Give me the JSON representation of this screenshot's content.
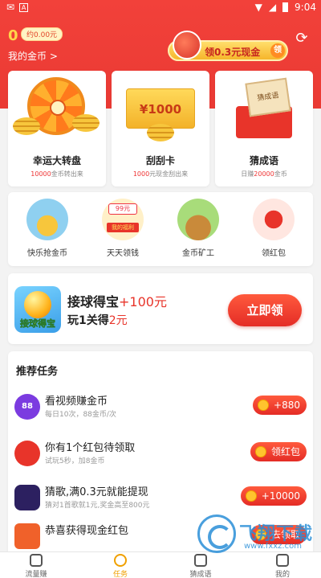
{
  "status": {
    "time": "9:04"
  },
  "header": {
    "coins": "0",
    "coins_value": "约0.00元",
    "my_coins": "我的金币 >",
    "banner_text": "领0.3元现金",
    "banner_tag": "领"
  },
  "top_cards": [
    {
      "title": "幸运大转盘",
      "sub_pre": "10000",
      "sub_post": "金币转出来"
    },
    {
      "title": "刮刮卡",
      "sub_pre": "1000",
      "sub_post": "元现金刮出来",
      "amount": "¥1000"
    },
    {
      "title": "猜成语",
      "sub_pre": "日赚",
      "sub_red": "20000",
      "sub_post": "金币",
      "paper": "猜成语"
    }
  ],
  "mid_items": [
    {
      "label": "快乐抢金币"
    },
    {
      "label": "天天领钱",
      "badge": "99元",
      "badge2": "我的福利"
    },
    {
      "label": "金币矿工"
    },
    {
      "label": "领红包"
    }
  ],
  "game": {
    "title": "接球得宝",
    "title_reward": "+100元",
    "sub_pre": "玩1关得",
    "sub_reward": "2元",
    "button": "立即领",
    "icon_text": "接球得宝"
  },
  "tasks": {
    "title": "推荐任务",
    "items": [
      {
        "name": "看视频赚金币",
        "desc": "每日10次，88金币/次",
        "button": "+880",
        "icon_text": "88"
      },
      {
        "name": "你有1个红包待领取",
        "desc": "试玩5秒，加8金币",
        "button": "领红包"
      },
      {
        "name": "猜歌,满0.3元就能提现",
        "desc": "猜对1首歌就1元,奖金高至800元",
        "button": "+10000"
      },
      {
        "name": "恭喜获得现金红包",
        "desc": "",
        "button": "去领取"
      }
    ]
  },
  "tabs": [
    {
      "label": "流量赚"
    },
    {
      "label": "任务"
    },
    {
      "label": "猜成语"
    },
    {
      "label": "我的"
    }
  ],
  "watermark": {
    "brand": "飞翔下载",
    "url": "www.fxxz.com"
  },
  "colors": {
    "primary": "#ea3a34",
    "gold": "#ffc42e",
    "active_tab": "#f0a000"
  }
}
